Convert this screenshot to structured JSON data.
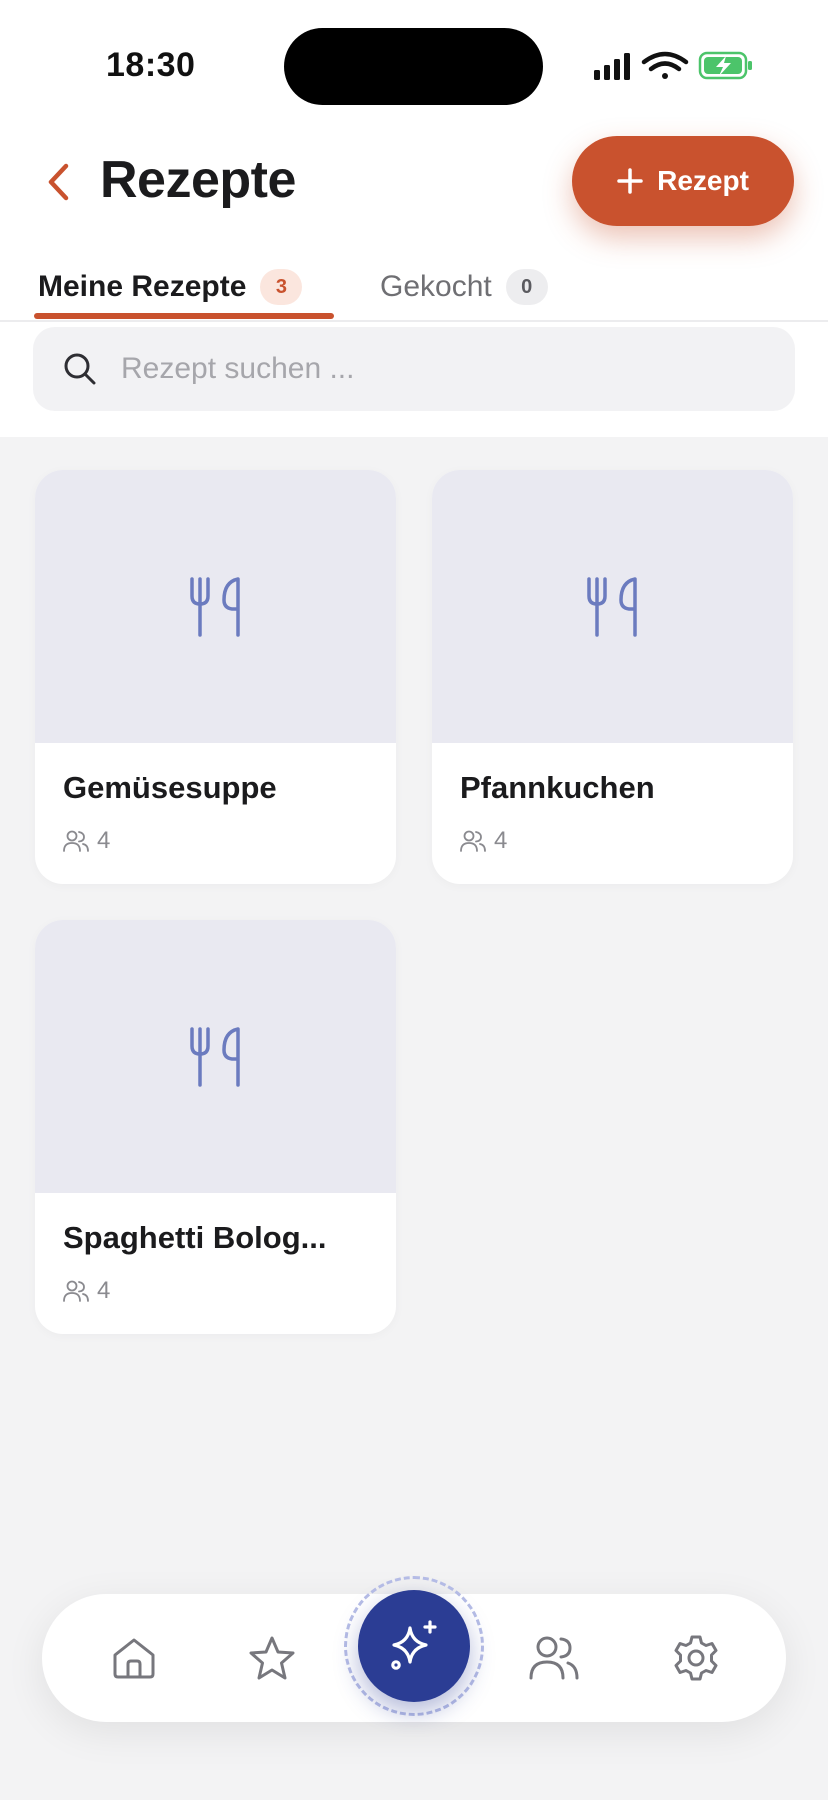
{
  "status_bar": {
    "time": "18:30",
    "icons": [
      "signal-icon",
      "wifi-icon",
      "battery-charging-icon"
    ]
  },
  "header": {
    "title": "Rezepte",
    "add_button_label": "Rezept",
    "back_icon": "chevron-left-icon"
  },
  "tabs": [
    {
      "label": "Meine Rezepte",
      "count": "3",
      "active": true
    },
    {
      "label": "Gekocht",
      "count": "0",
      "active": false
    }
  ],
  "search": {
    "placeholder": "Rezept suchen ...",
    "value": ""
  },
  "recipes": [
    {
      "title": "Gemüsesuppe",
      "servings": "4",
      "image_icon": "cutlery-icon"
    },
    {
      "title": "Pfannkuchen",
      "servings": "4",
      "image_icon": "cutlery-icon"
    },
    {
      "title": "Spaghetti Bolog...",
      "servings": "4",
      "image_icon": "cutlery-icon"
    }
  ],
  "bottom_nav": {
    "items": [
      "home-icon",
      "star-icon",
      "sparkles-icon",
      "users-icon",
      "settings-icon"
    ],
    "active": "sparkles-icon"
  },
  "colors": {
    "accent": "#c9522e",
    "fab": "#2b3d94",
    "placeholder_icon": "#6b7bbf",
    "background": "#f3f3f4"
  }
}
